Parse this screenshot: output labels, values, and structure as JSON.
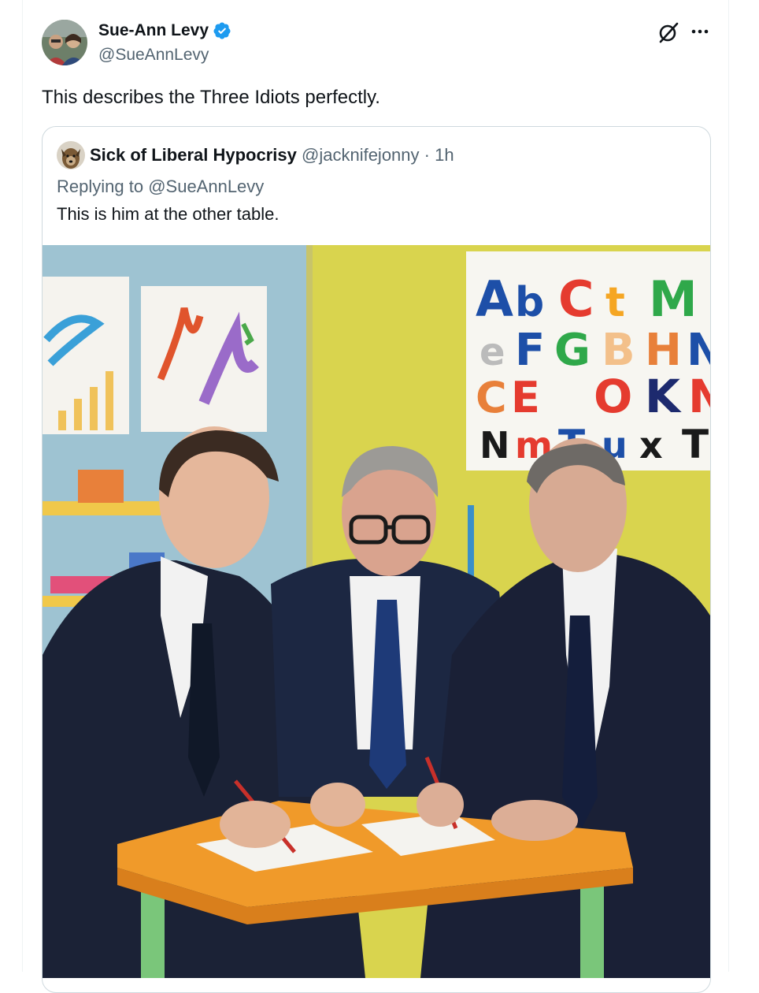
{
  "tweet": {
    "display_name": "Sue-Ann Levy",
    "handle": "@SueAnnLevy",
    "text": "This describes the Three Idiots perfectly.",
    "verified": true,
    "icons": [
      "grok-icon",
      "more-icon",
      "verified-badge-icon"
    ]
  },
  "quote": {
    "display_name": "Sick of Liberal Hypocrisy",
    "handle": "@jacknifejonny",
    "separator": "·",
    "time": "1h",
    "replying_prefix": "Replying to",
    "replying_handle": "@SueAnnLevy",
    "text": "This is him at the other table."
  },
  "image_poster_letters": {
    "row1": [
      "A",
      "b",
      "C",
      "t",
      "M"
    ],
    "row2": [
      "e",
      "F",
      "G",
      "B",
      "H",
      "N"
    ],
    "row3": [
      "C",
      "E",
      "O",
      "K",
      "N"
    ],
    "row4": [
      "N",
      "m",
      "T",
      "u",
      "x",
      "T"
    ]
  },
  "colors": {
    "verified_blue": "#1d9bf0",
    "secondary_text": "#536471",
    "border": "#cfd9de"
  }
}
